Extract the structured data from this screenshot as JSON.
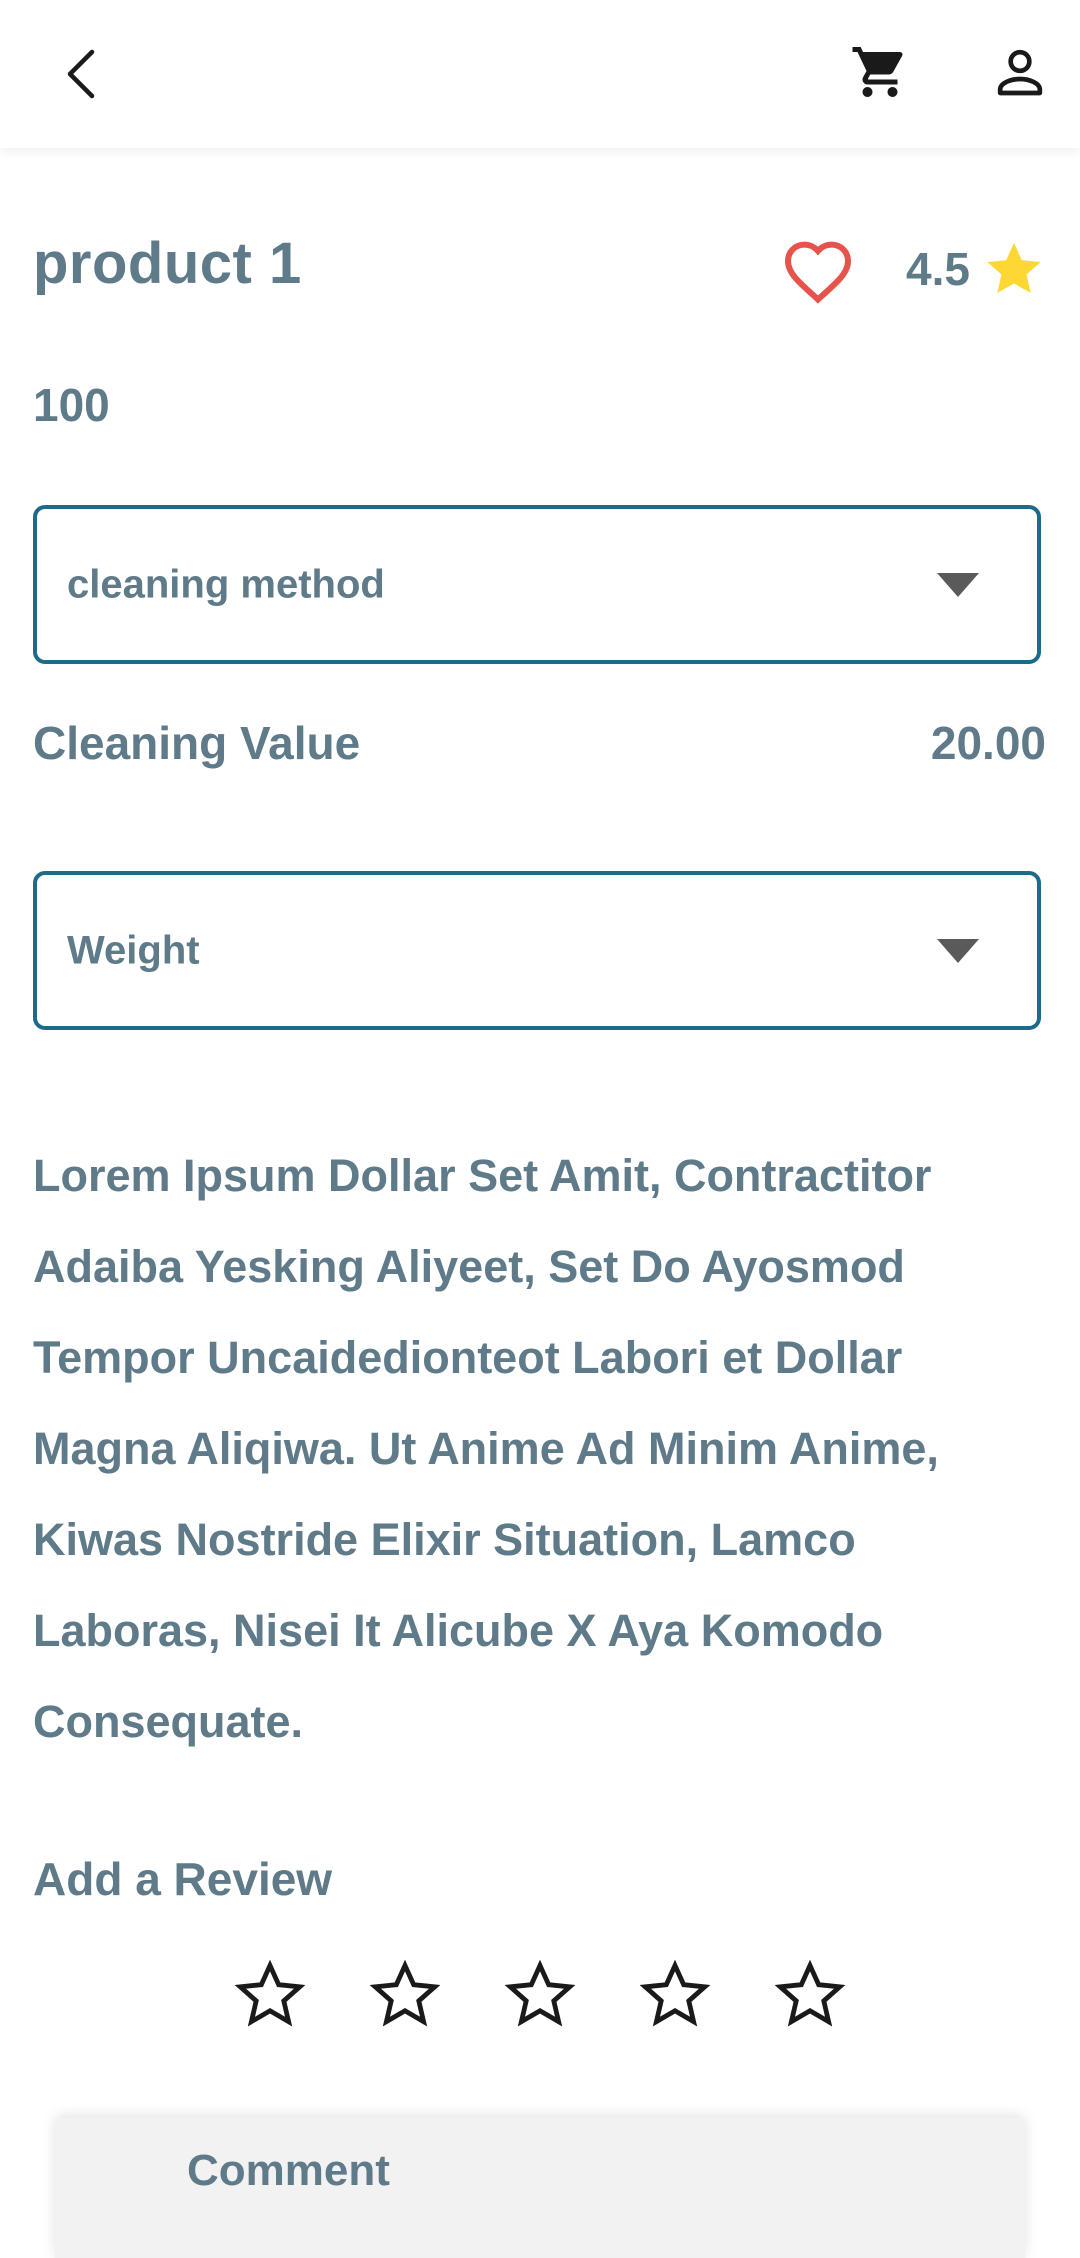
{
  "header": {
    "back_icon": "chevron-left-icon",
    "cart_icon": "shopping-cart-icon",
    "profile_icon": "user-icon"
  },
  "product": {
    "name": "product 1",
    "rating": "4.5",
    "price": "100",
    "favorite_icon": "heart-outline-icon",
    "accent_heart": "#e5534b",
    "accent_star": "#fdd835"
  },
  "cleaning_dropdown": {
    "label": "cleaning method"
  },
  "cleaning_value": {
    "label": "Cleaning Value",
    "value": "20.00"
  },
  "weight_dropdown": {
    "label": "Weight"
  },
  "description": "Lorem Ipsum Dollar Set Amit, Contractitor Adaiba Yesking Aliyeet, Set Do Ayosmod Tempor Uncaidedionteot Labori et Dollar Magna Aliqiwa. Ut Anime Ad Minim Anime, Kiwas Nostride Elixir Situation, Lamco Laboras, Nisei It Alicube X Aya Komodo Consequate.",
  "review": {
    "title": "Add a Review",
    "stars_selected": 0,
    "stars_total": 5,
    "comment_label": "Comment"
  },
  "colors": {
    "text": "#5f7a89",
    "border": "#1d6a8b",
    "icon": "#1a1a1a"
  }
}
